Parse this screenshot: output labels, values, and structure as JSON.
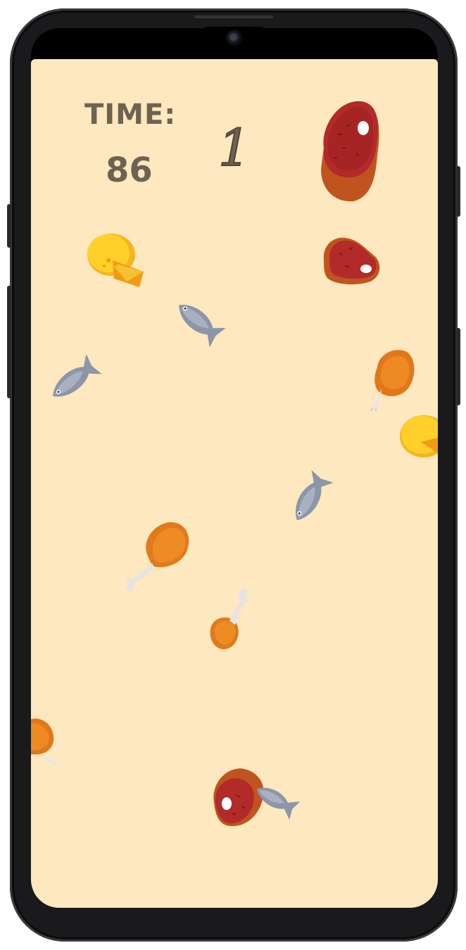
{
  "hud": {
    "time_label": "TIME:",
    "time_value": "86",
    "score": "1"
  },
  "foods": [
    {
      "kind": "steak-icon"
    },
    {
      "kind": "cheese-icon"
    },
    {
      "kind": "steak-icon"
    },
    {
      "kind": "fish-icon"
    },
    {
      "kind": "fish-icon"
    },
    {
      "kind": "roast-chicken-icon"
    },
    {
      "kind": "cheese-icon"
    },
    {
      "kind": "fish-icon"
    },
    {
      "kind": "drumstick-icon"
    },
    {
      "kind": "drumstick-icon"
    },
    {
      "kind": "roast-chicken-icon"
    },
    {
      "kind": "steak-icon"
    },
    {
      "kind": "fish-icon"
    }
  ],
  "colors": {
    "background": "#fde8bf",
    "text": "#6e6350"
  }
}
